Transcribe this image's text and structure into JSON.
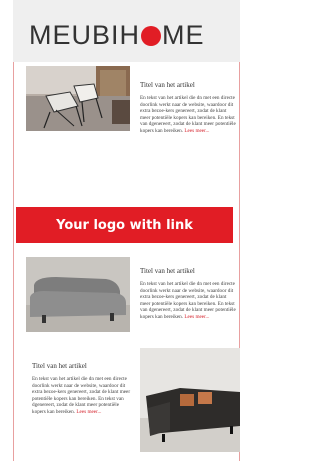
{
  "header": {
    "logo_left": "MEUBIH",
    "logo_right": "ME"
  },
  "articles": [
    {
      "title": "Titel van het artikel",
      "body": "En tekst van het artikel die dn met een directe doorlink werkt naar de website, waardoor dit extra bezoe-kers genereert, zodat de klant meer potentiële kopers kan bereiken. En tekst van dgenereert, zodat de klant meer potentiële kopers kan bereiken.",
      "link": "Lees meer..."
    },
    {
      "title": "Titel van het artikel",
      "body": "En tekst van het artikel die dn met een directe doorlink werkt naar de website, waardoor dit extra bezoe-kers genereert, zodat de klant meer potentiële kopers kan bereiken. En tekst van dgenereert, zodat de klant meer potentiële kopers kan bereiken.",
      "link": "Lees meer..."
    },
    {
      "title": "Titel van het artikel",
      "body": "En tekst van het artikel die dn met een directe doorlink werkt naar de website, waardoor dit extra bezoe-kers genereert, zodat de klant meer potentiële kopers kan bereiken. En tekst van dgenereert, zodat de klant meer potentiële kopers kan bereiken.",
      "link": "Lees meer..."
    }
  ],
  "cta": {
    "label": "Your logo with link"
  },
  "colors": {
    "accent": "#e11d25",
    "header_bg": "#efefef"
  }
}
